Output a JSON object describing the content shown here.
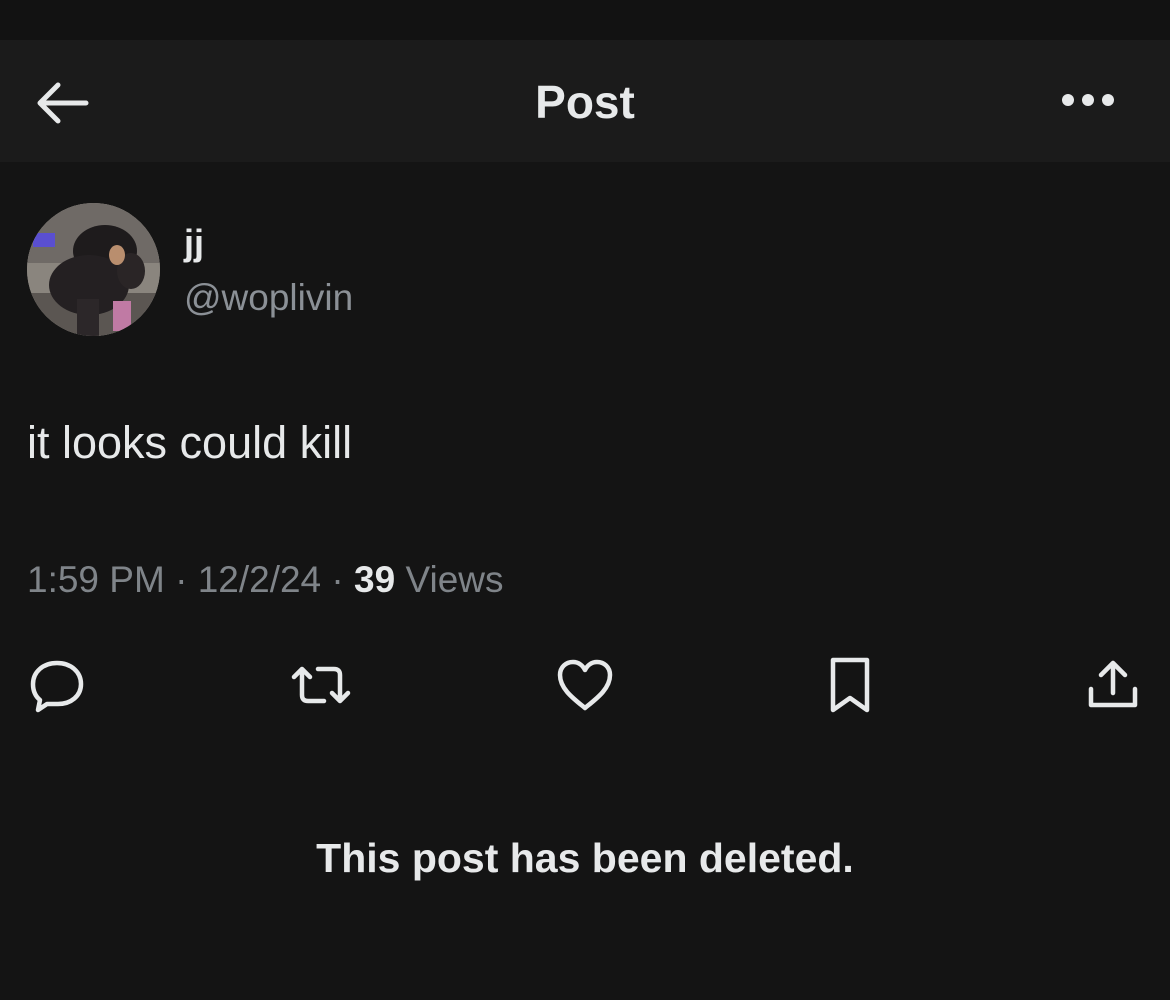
{
  "header": {
    "title": "Post",
    "back_icon": "arrow-left-icon",
    "more_icon": "more-horizontal-icon"
  },
  "author": {
    "display_name": "jj",
    "handle": "@woplivin"
  },
  "post": {
    "text": "it looks could kill",
    "time": "1:59 PM",
    "date": "12/2/24",
    "views_count": "39",
    "views_label": "Views"
  },
  "actions": [
    {
      "name": "reply",
      "icon": "reply-icon"
    },
    {
      "name": "repost",
      "icon": "repost-icon"
    },
    {
      "name": "like",
      "icon": "heart-icon"
    },
    {
      "name": "bookmark",
      "icon": "bookmark-icon"
    },
    {
      "name": "share",
      "icon": "share-icon"
    }
  ],
  "notice": "This post has been deleted.",
  "colors": {
    "background": "#141414",
    "header_background": "#1b1b1b",
    "text_primary": "#e7e9ea",
    "text_secondary": "#8b9096"
  }
}
